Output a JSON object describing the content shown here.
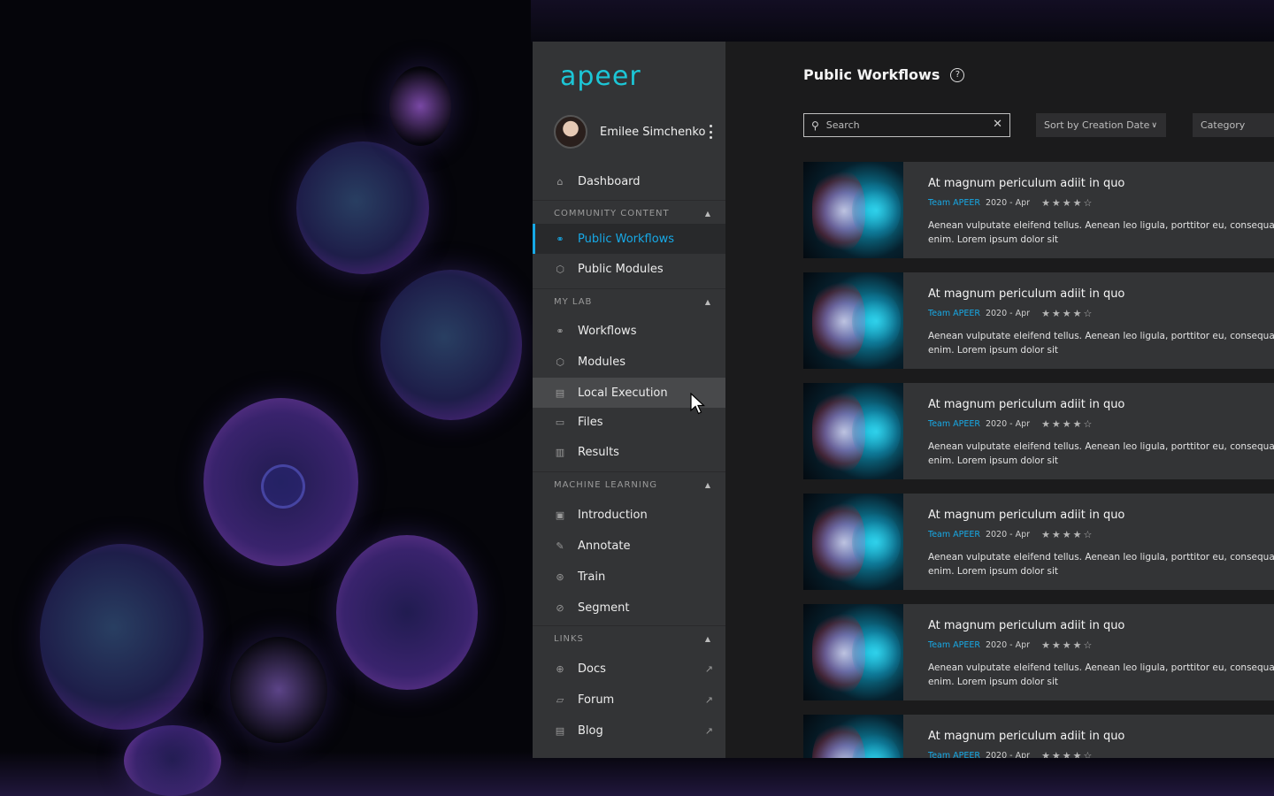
{
  "brand": {
    "logo_text": "apeer",
    "accent_color": "#17a9e6",
    "logo_color": "#1cc6d6"
  },
  "user": {
    "name": "Emilee Simchenko",
    "menu_icon": "kebab-menu-icon"
  },
  "nav": {
    "dashboard": {
      "label": "Dashboard",
      "icon": "home-icon"
    },
    "sections": {
      "community": "COMMUNITY CONTENT",
      "mylab": "MY LAB",
      "ml": "MACHINE LEARNING",
      "links": "LINKS"
    },
    "public_workflows": "Public Workflows",
    "public_modules": "Public Modules",
    "workflows": "Workflows",
    "modules": "Modules",
    "local_execution": "Local Execution",
    "files": "Files",
    "results": "Results",
    "introduction": "Introduction",
    "annotate": "Annotate",
    "train": "Train",
    "segment": "Segment",
    "docs": "Docs",
    "forum": "Forum",
    "blog": "Blog"
  },
  "main": {
    "title": "Public Workflows",
    "search_placeholder": "Search",
    "sort_label": "Sort by Creation Date",
    "category_label": "Category"
  },
  "cards": [
    {
      "title": "At magnum periculum adiit in quo",
      "team": "Team APEER",
      "date": "2020 - Apr",
      "rating": 4,
      "stars": "★★★★☆",
      "desc1": "Aenean vulputate eleifend tellus. Aenean leo ligula, porttitor eu, consequat vitae, e",
      "desc2": "enim. Lorem ipsum dolor sit"
    },
    {
      "title": "At magnum periculum adiit in quo",
      "team": "Team APEER",
      "date": "2020 - Apr",
      "rating": 4,
      "stars": "★★★★☆",
      "desc1": "Aenean vulputate eleifend tellus. Aenean leo ligula, porttitor eu, consequat vitae, e",
      "desc2": "enim. Lorem ipsum dolor sit"
    },
    {
      "title": "At magnum periculum adiit in quo",
      "team": "Team APEER",
      "date": "2020 - Apr",
      "rating": 4,
      "stars": "★★★★☆",
      "desc1": "Aenean vulputate eleifend tellus. Aenean leo ligula, porttitor eu, consequat vitae, e",
      "desc2": "enim. Lorem ipsum dolor sit"
    },
    {
      "title": "At magnum periculum adiit in quo",
      "team": "Team APEER",
      "date": "2020 - Apr",
      "rating": 4,
      "stars": "★★★★☆",
      "desc1": "Aenean vulputate eleifend tellus. Aenean leo ligula, porttitor eu, consequat vitae, e",
      "desc2": "enim. Lorem ipsum dolor sit"
    },
    {
      "title": "At magnum periculum adiit in quo",
      "team": "Team APEER",
      "date": "2020 - Apr",
      "rating": 4,
      "stars": "★★★★☆",
      "desc1": "Aenean vulputate eleifend tellus. Aenean leo ligula, porttitor eu, consequat vitae, e",
      "desc2": "enim. Lorem ipsum dolor sit"
    },
    {
      "title": "At magnum periculum adiit in quo",
      "team": "Team APEER",
      "date": "2020 - Apr",
      "rating": 4,
      "stars": "★★★★☆"
    }
  ]
}
